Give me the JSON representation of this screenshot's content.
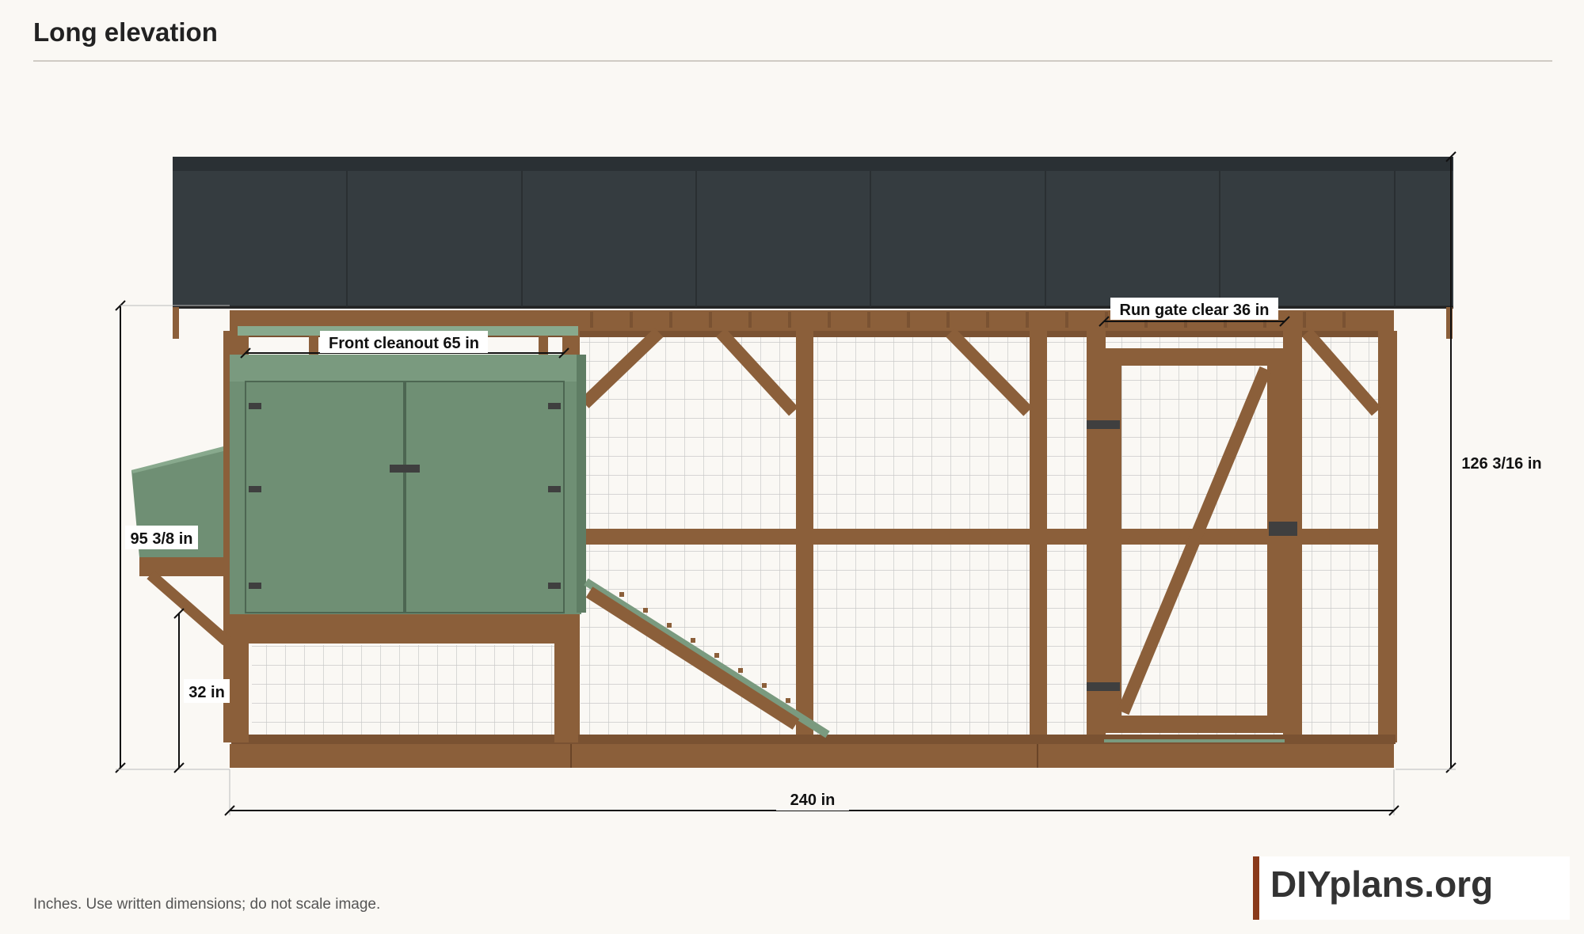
{
  "title": "Long elevation",
  "footnote": "Inches. Use written dimensions; do not scale image.",
  "logo": "DIYplans.org",
  "dimensions": {
    "overall_length": "240 in",
    "overall_height": "126 3/16 in",
    "coop_height": "95 3/8 in",
    "floor_height": "32 in",
    "front_cleanout": "Front cleanout 65 in",
    "run_gate": "Run gate clear 36 in"
  },
  "colors": {
    "roof": "#353c40",
    "frame": "#8b5f3a",
    "coop": "#6f8f74",
    "hardware": "#3f3f3f",
    "mesh": "#c9c9c9",
    "accent": "#8a3a1a"
  }
}
